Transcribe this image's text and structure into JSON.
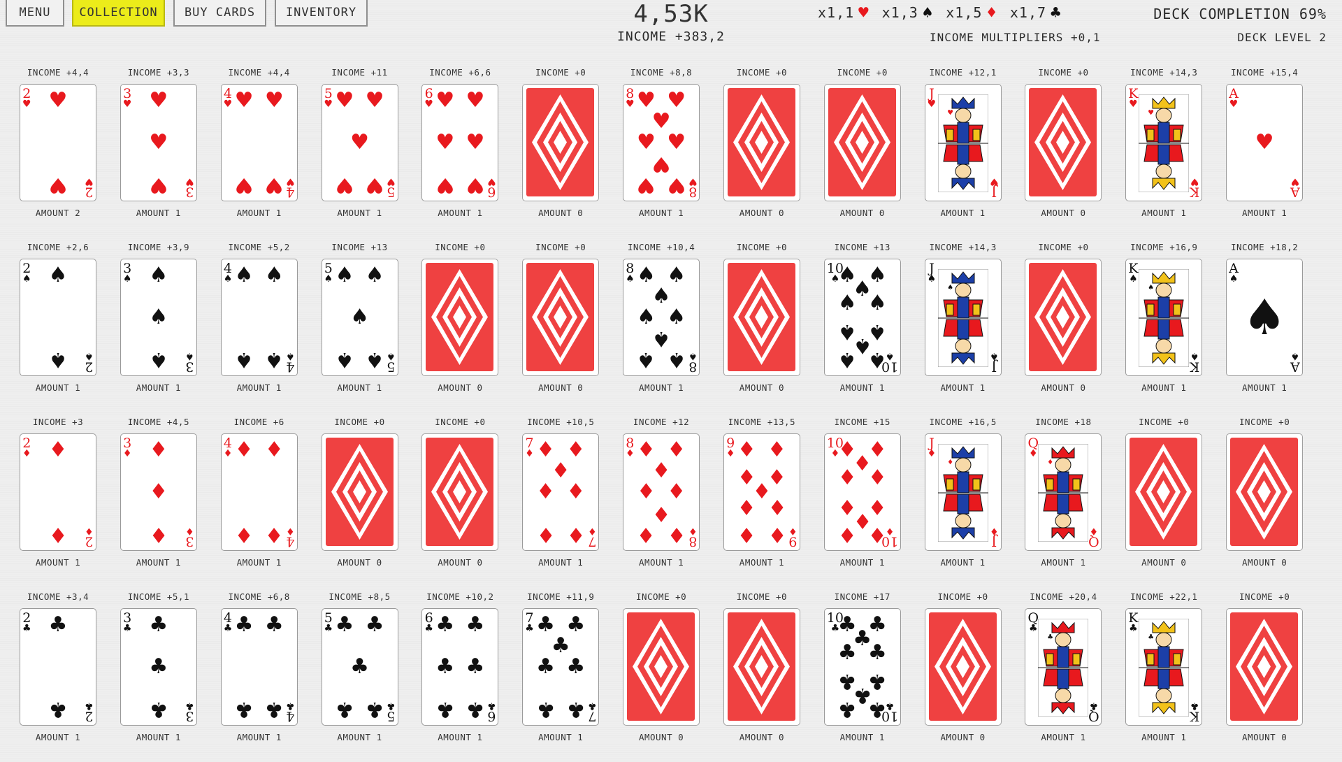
{
  "nav": {
    "menu": "MENU",
    "collection": "COLLECTION",
    "buy_cards": "BUY CARDS",
    "inventory": "INVENTORY"
  },
  "score": "4,53K",
  "income": "INCOME +383,2",
  "multipliers": [
    {
      "value": "x1,1",
      "suit": "♥",
      "color": "#e8191e"
    },
    {
      "value": "x1,3",
      "suit": "♠",
      "color": "#111111"
    },
    {
      "value": "x1,5",
      "suit": "♦",
      "color": "#e8191e"
    },
    {
      "value": "x1,7",
      "suit": "♣",
      "color": "#111111"
    }
  ],
  "multipliers_label": "INCOME MULTIPLIERS +0,1",
  "deck_completion": "DECK COMPLETION 69%",
  "deck_level": "DECK LEVEL 2",
  "colors": {
    "accent_yellow": "#ecec1a",
    "card_red": "#e8191e",
    "back_red": "#ef4141"
  },
  "rows": [
    {
      "suit": "hearts",
      "symbol": "♥",
      "color": "red",
      "cards": [
        {
          "rank": "2",
          "income": "INCOME +4,4",
          "amount": "AMOUNT 2",
          "owned": true
        },
        {
          "rank": "3",
          "income": "INCOME +3,3",
          "amount": "AMOUNT 1",
          "owned": true
        },
        {
          "rank": "4",
          "income": "INCOME +4,4",
          "amount": "AMOUNT 1",
          "owned": true
        },
        {
          "rank": "5",
          "income": "INCOME +11",
          "amount": "AMOUNT 1",
          "owned": true
        },
        {
          "rank": "6",
          "income": "INCOME +6,6",
          "amount": "AMOUNT 1",
          "owned": true
        },
        {
          "rank": "7",
          "income": "INCOME +0",
          "amount": "AMOUNT 0",
          "owned": false
        },
        {
          "rank": "8",
          "income": "INCOME +8,8",
          "amount": "AMOUNT 1",
          "owned": true
        },
        {
          "rank": "9",
          "income": "INCOME +0",
          "amount": "AMOUNT 0",
          "owned": false
        },
        {
          "rank": "10",
          "income": "INCOME +0",
          "amount": "AMOUNT 0",
          "owned": false
        },
        {
          "rank": "J",
          "income": "INCOME +12,1",
          "amount": "AMOUNT 1",
          "owned": true
        },
        {
          "rank": "Q",
          "income": "INCOME +0",
          "amount": "AMOUNT 0",
          "owned": false
        },
        {
          "rank": "K",
          "income": "INCOME +14,3",
          "amount": "AMOUNT 1",
          "owned": true
        },
        {
          "rank": "A",
          "income": "INCOME +15,4",
          "amount": "AMOUNT 1",
          "owned": true
        }
      ]
    },
    {
      "suit": "spades",
      "symbol": "♠",
      "color": "black",
      "cards": [
        {
          "rank": "2",
          "income": "INCOME +2,6",
          "amount": "AMOUNT 1",
          "owned": true
        },
        {
          "rank": "3",
          "income": "INCOME +3,9",
          "amount": "AMOUNT 1",
          "owned": true
        },
        {
          "rank": "4",
          "income": "INCOME +5,2",
          "amount": "AMOUNT 1",
          "owned": true
        },
        {
          "rank": "5",
          "income": "INCOME +13",
          "amount": "AMOUNT 1",
          "owned": true
        },
        {
          "rank": "6",
          "income": "INCOME +0",
          "amount": "AMOUNT 0",
          "owned": false
        },
        {
          "rank": "7",
          "income": "INCOME +0",
          "amount": "AMOUNT 0",
          "owned": false
        },
        {
          "rank": "8",
          "income": "INCOME +10,4",
          "amount": "AMOUNT 1",
          "owned": true
        },
        {
          "rank": "9",
          "income": "INCOME +0",
          "amount": "AMOUNT 0",
          "owned": false
        },
        {
          "rank": "10",
          "income": "INCOME +13",
          "amount": "AMOUNT 1",
          "owned": true
        },
        {
          "rank": "J",
          "income": "INCOME +14,3",
          "amount": "AMOUNT 1",
          "owned": true
        },
        {
          "rank": "Q",
          "income": "INCOME +0",
          "amount": "AMOUNT 0",
          "owned": false
        },
        {
          "rank": "K",
          "income": "INCOME +16,9",
          "amount": "AMOUNT 1",
          "owned": true
        },
        {
          "rank": "A",
          "income": "INCOME +18,2",
          "amount": "AMOUNT 1",
          "owned": true
        }
      ]
    },
    {
      "suit": "diamonds",
      "symbol": "♦",
      "color": "red",
      "cards": [
        {
          "rank": "2",
          "income": "INCOME +3",
          "amount": "AMOUNT 1",
          "owned": true
        },
        {
          "rank": "3",
          "income": "INCOME +4,5",
          "amount": "AMOUNT 1",
          "owned": true
        },
        {
          "rank": "4",
          "income": "INCOME +6",
          "amount": "AMOUNT 1",
          "owned": true
        },
        {
          "rank": "5",
          "income": "INCOME +0",
          "amount": "AMOUNT 0",
          "owned": false
        },
        {
          "rank": "6",
          "income": "INCOME +0",
          "amount": "AMOUNT 0",
          "owned": false
        },
        {
          "rank": "7",
          "income": "INCOME +10,5",
          "amount": "AMOUNT 1",
          "owned": true
        },
        {
          "rank": "8",
          "income": "INCOME +12",
          "amount": "AMOUNT 1",
          "owned": true
        },
        {
          "rank": "9",
          "income": "INCOME +13,5",
          "amount": "AMOUNT 1",
          "owned": true
        },
        {
          "rank": "10",
          "income": "INCOME +15",
          "amount": "AMOUNT 1",
          "owned": true
        },
        {
          "rank": "J",
          "income": "INCOME +16,5",
          "amount": "AMOUNT 1",
          "owned": true
        },
        {
          "rank": "Q",
          "income": "INCOME +18",
          "amount": "AMOUNT 1",
          "owned": true
        },
        {
          "rank": "K",
          "income": "INCOME +0",
          "amount": "AMOUNT 0",
          "owned": false
        },
        {
          "rank": "A",
          "income": "INCOME +0",
          "amount": "AMOUNT 0",
          "owned": false
        }
      ]
    },
    {
      "suit": "clubs",
      "symbol": "♣",
      "color": "black",
      "cards": [
        {
          "rank": "2",
          "income": "INCOME +3,4",
          "amount": "AMOUNT 1",
          "owned": true
        },
        {
          "rank": "3",
          "income": "INCOME +5,1",
          "amount": "AMOUNT 1",
          "owned": true
        },
        {
          "rank": "4",
          "income": "INCOME +6,8",
          "amount": "AMOUNT 1",
          "owned": true
        },
        {
          "rank": "5",
          "income": "INCOME +8,5",
          "amount": "AMOUNT 1",
          "owned": true
        },
        {
          "rank": "6",
          "income": "INCOME +10,2",
          "amount": "AMOUNT 1",
          "owned": true
        },
        {
          "rank": "7",
          "income": "INCOME +11,9",
          "amount": "AMOUNT 1",
          "owned": true
        },
        {
          "rank": "8",
          "income": "INCOME +0",
          "amount": "AMOUNT 0",
          "owned": false
        },
        {
          "rank": "9",
          "income": "INCOME +0",
          "amount": "AMOUNT 0",
          "owned": false
        },
        {
          "rank": "10",
          "income": "INCOME +17",
          "amount": "AMOUNT 1",
          "owned": true
        },
        {
          "rank": "J",
          "income": "INCOME +0",
          "amount": "AMOUNT 0",
          "owned": false
        },
        {
          "rank": "Q",
          "income": "INCOME +20,4",
          "amount": "AMOUNT 1",
          "owned": true
        },
        {
          "rank": "K",
          "income": "INCOME +22,1",
          "amount": "AMOUNT 1",
          "owned": true
        },
        {
          "rank": "A",
          "income": "INCOME +0",
          "amount": "AMOUNT 0",
          "owned": false
        }
      ]
    }
  ]
}
